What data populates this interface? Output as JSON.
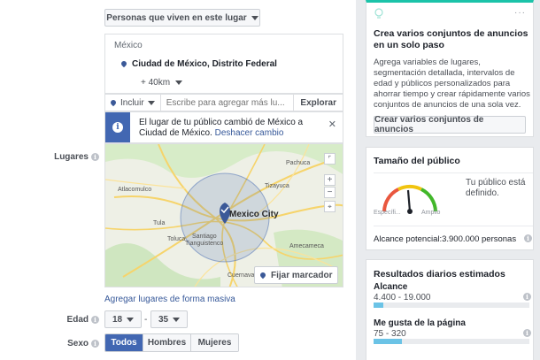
{
  "location_filter": {
    "label": "Personas que viven en este lugar"
  },
  "location_box": {
    "country": "México",
    "city": "Ciudad de México, Distrito Federal",
    "radius": "+ 40km"
  },
  "include_bar": {
    "include_label": "Incluir",
    "search_placeholder": "Escribe para agregar más lu...",
    "explore_label": "Explorar"
  },
  "notice": {
    "text": "El lugar de tu público cambió de México a Ciudad de México.",
    "undo_link": "Deshacer cambio"
  },
  "map": {
    "center_label": "Mexico City",
    "places": [
      "Atlacomulco",
      "Pachuca",
      "Tizayuca",
      "Amecameca",
      "Toluca",
      "Santiago",
      "Tianguistenco",
      "Cuernavaca",
      "Tula"
    ],
    "drop_pin_label": "Fijar marcador",
    "zoom_in": "+",
    "zoom_out": "−"
  },
  "bulk_locations_link": "Agregar lugares de forma masiva",
  "labels": {
    "places": "Lugares",
    "age": "Edad",
    "sex": "Sexo"
  },
  "age": {
    "min": "18",
    "dash": "-",
    "max": "35"
  },
  "gender_tabs": [
    "Todos",
    "Hombres",
    "Mujeres"
  ],
  "gender_selected": 0,
  "colors": {
    "accent": "#4267b2",
    "link": "#365899",
    "gauge_green": "#42b72a",
    "gauge_red": "#e9573f",
    "progress": "#6bc3e6"
  },
  "promo_card": {
    "menu_glyph": "···",
    "title": "Crea varios conjuntos de anuncios en un solo paso",
    "body": "Agrega variables de lugares, segmentación detallada, intervalos de edad y públicos personalizados para ahorrar tiempo y crear rápidamente varios conjuntos de anuncios de una sola vez.",
    "button": "Crear varios conjuntos de anuncios"
  },
  "audience_card": {
    "title": "Tamaño del público",
    "gauge_left": "Específi...",
    "gauge_right": "Amplio",
    "description": "Tu público está definido.",
    "potential_reach": "Alcance potencial:3.900.000 personas"
  },
  "results_card": {
    "title": "Resultados diarios estimados",
    "metrics": [
      {
        "label": "Alcance",
        "value": "4.400 - 19.000",
        "fill_fraction": 0.06
      },
      {
        "label": "Me gusta de la página",
        "value": "75 - 320",
        "fill_fraction": 0.18
      }
    ]
  }
}
